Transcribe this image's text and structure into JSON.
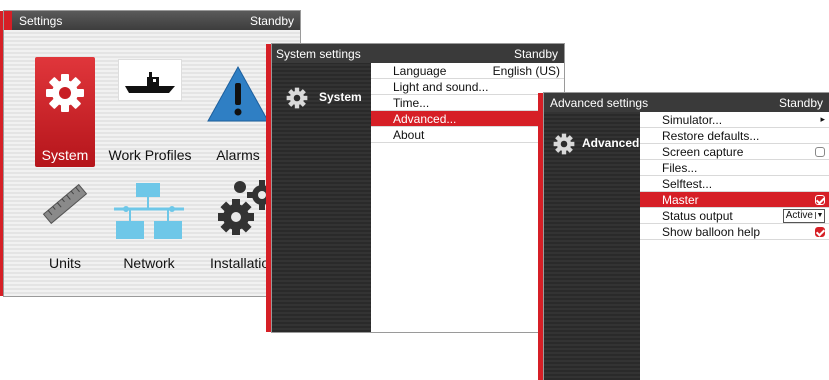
{
  "settings_window": {
    "title": "Settings",
    "status": "Standby",
    "tiles": [
      {
        "label": "System",
        "icon": "gear-icon"
      },
      {
        "label": "Work Profiles",
        "icon": "boat-icon"
      },
      {
        "label": "Alarms",
        "icon": "warning-icon"
      },
      {
        "label": "Units",
        "icon": "ruler-icon"
      },
      {
        "label": "Network",
        "icon": "network-icon"
      },
      {
        "label": "Installation",
        "icon": "gears-icon"
      }
    ]
  },
  "system_window": {
    "title": "System settings",
    "status": "Standby",
    "section": "System",
    "items": [
      {
        "label": "Language",
        "value": "English (US)"
      },
      {
        "label": "Light and sound..."
      },
      {
        "label": "Time..."
      },
      {
        "label": "Advanced..."
      },
      {
        "label": "About"
      }
    ]
  },
  "advanced_window": {
    "title": "Advanced settings",
    "status": "Standby",
    "section": "Advanced",
    "items": [
      {
        "label": "Simulator...",
        "marker": "▸"
      },
      {
        "label": "Restore defaults..."
      },
      {
        "label": "Screen capture",
        "checked": false
      },
      {
        "label": "Files..."
      },
      {
        "label": "Selftest..."
      },
      {
        "label": "Master",
        "checked": true
      },
      {
        "label": "Status output",
        "value": "Active"
      },
      {
        "label": "Show balloon help",
        "checked": true
      }
    ]
  },
  "colors": {
    "accent": "#d61f26",
    "warning": "#2f7fc4",
    "network": "#6ec7e8"
  }
}
